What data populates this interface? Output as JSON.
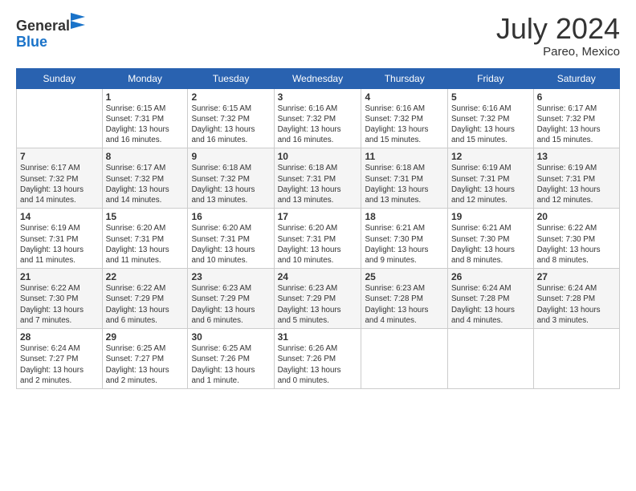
{
  "logo": {
    "general": "General",
    "blue": "Blue"
  },
  "header": {
    "month": "July 2024",
    "location": "Pareo, Mexico"
  },
  "weekdays": [
    "Sunday",
    "Monday",
    "Tuesday",
    "Wednesday",
    "Thursday",
    "Friday",
    "Saturday"
  ],
  "weeks": [
    [
      {
        "day": "",
        "info": ""
      },
      {
        "day": "1",
        "info": "Sunrise: 6:15 AM\nSunset: 7:31 PM\nDaylight: 13 hours\nand 16 minutes."
      },
      {
        "day": "2",
        "info": "Sunrise: 6:15 AM\nSunset: 7:32 PM\nDaylight: 13 hours\nand 16 minutes."
      },
      {
        "day": "3",
        "info": "Sunrise: 6:16 AM\nSunset: 7:32 PM\nDaylight: 13 hours\nand 16 minutes."
      },
      {
        "day": "4",
        "info": "Sunrise: 6:16 AM\nSunset: 7:32 PM\nDaylight: 13 hours\nand 15 minutes."
      },
      {
        "day": "5",
        "info": "Sunrise: 6:16 AM\nSunset: 7:32 PM\nDaylight: 13 hours\nand 15 minutes."
      },
      {
        "day": "6",
        "info": "Sunrise: 6:17 AM\nSunset: 7:32 PM\nDaylight: 13 hours\nand 15 minutes."
      }
    ],
    [
      {
        "day": "7",
        "info": "Sunrise: 6:17 AM\nSunset: 7:32 PM\nDaylight: 13 hours\nand 14 minutes."
      },
      {
        "day": "8",
        "info": "Sunrise: 6:17 AM\nSunset: 7:32 PM\nDaylight: 13 hours\nand 14 minutes."
      },
      {
        "day": "9",
        "info": "Sunrise: 6:18 AM\nSunset: 7:32 PM\nDaylight: 13 hours\nand 13 minutes."
      },
      {
        "day": "10",
        "info": "Sunrise: 6:18 AM\nSunset: 7:31 PM\nDaylight: 13 hours\nand 13 minutes."
      },
      {
        "day": "11",
        "info": "Sunrise: 6:18 AM\nSunset: 7:31 PM\nDaylight: 13 hours\nand 13 minutes."
      },
      {
        "day": "12",
        "info": "Sunrise: 6:19 AM\nSunset: 7:31 PM\nDaylight: 13 hours\nand 12 minutes."
      },
      {
        "day": "13",
        "info": "Sunrise: 6:19 AM\nSunset: 7:31 PM\nDaylight: 13 hours\nand 12 minutes."
      }
    ],
    [
      {
        "day": "14",
        "info": "Sunrise: 6:19 AM\nSunset: 7:31 PM\nDaylight: 13 hours\nand 11 minutes."
      },
      {
        "day": "15",
        "info": "Sunrise: 6:20 AM\nSunset: 7:31 PM\nDaylight: 13 hours\nand 11 minutes."
      },
      {
        "day": "16",
        "info": "Sunrise: 6:20 AM\nSunset: 7:31 PM\nDaylight: 13 hours\nand 10 minutes."
      },
      {
        "day": "17",
        "info": "Sunrise: 6:20 AM\nSunset: 7:31 PM\nDaylight: 13 hours\nand 10 minutes."
      },
      {
        "day": "18",
        "info": "Sunrise: 6:21 AM\nSunset: 7:30 PM\nDaylight: 13 hours\nand 9 minutes."
      },
      {
        "day": "19",
        "info": "Sunrise: 6:21 AM\nSunset: 7:30 PM\nDaylight: 13 hours\nand 8 minutes."
      },
      {
        "day": "20",
        "info": "Sunrise: 6:22 AM\nSunset: 7:30 PM\nDaylight: 13 hours\nand 8 minutes."
      }
    ],
    [
      {
        "day": "21",
        "info": "Sunrise: 6:22 AM\nSunset: 7:30 PM\nDaylight: 13 hours\nand 7 minutes."
      },
      {
        "day": "22",
        "info": "Sunrise: 6:22 AM\nSunset: 7:29 PM\nDaylight: 13 hours\nand 6 minutes."
      },
      {
        "day": "23",
        "info": "Sunrise: 6:23 AM\nSunset: 7:29 PM\nDaylight: 13 hours\nand 6 minutes."
      },
      {
        "day": "24",
        "info": "Sunrise: 6:23 AM\nSunset: 7:29 PM\nDaylight: 13 hours\nand 5 minutes."
      },
      {
        "day": "25",
        "info": "Sunrise: 6:23 AM\nSunset: 7:28 PM\nDaylight: 13 hours\nand 4 minutes."
      },
      {
        "day": "26",
        "info": "Sunrise: 6:24 AM\nSunset: 7:28 PM\nDaylight: 13 hours\nand 4 minutes."
      },
      {
        "day": "27",
        "info": "Sunrise: 6:24 AM\nSunset: 7:28 PM\nDaylight: 13 hours\nand 3 minutes."
      }
    ],
    [
      {
        "day": "28",
        "info": "Sunrise: 6:24 AM\nSunset: 7:27 PM\nDaylight: 13 hours\nand 2 minutes."
      },
      {
        "day": "29",
        "info": "Sunrise: 6:25 AM\nSunset: 7:27 PM\nDaylight: 13 hours\nand 2 minutes."
      },
      {
        "day": "30",
        "info": "Sunrise: 6:25 AM\nSunset: 7:26 PM\nDaylight: 13 hours\nand 1 minute."
      },
      {
        "day": "31",
        "info": "Sunrise: 6:26 AM\nSunset: 7:26 PM\nDaylight: 13 hours\nand 0 minutes."
      },
      {
        "day": "",
        "info": ""
      },
      {
        "day": "",
        "info": ""
      },
      {
        "day": "",
        "info": ""
      }
    ]
  ]
}
